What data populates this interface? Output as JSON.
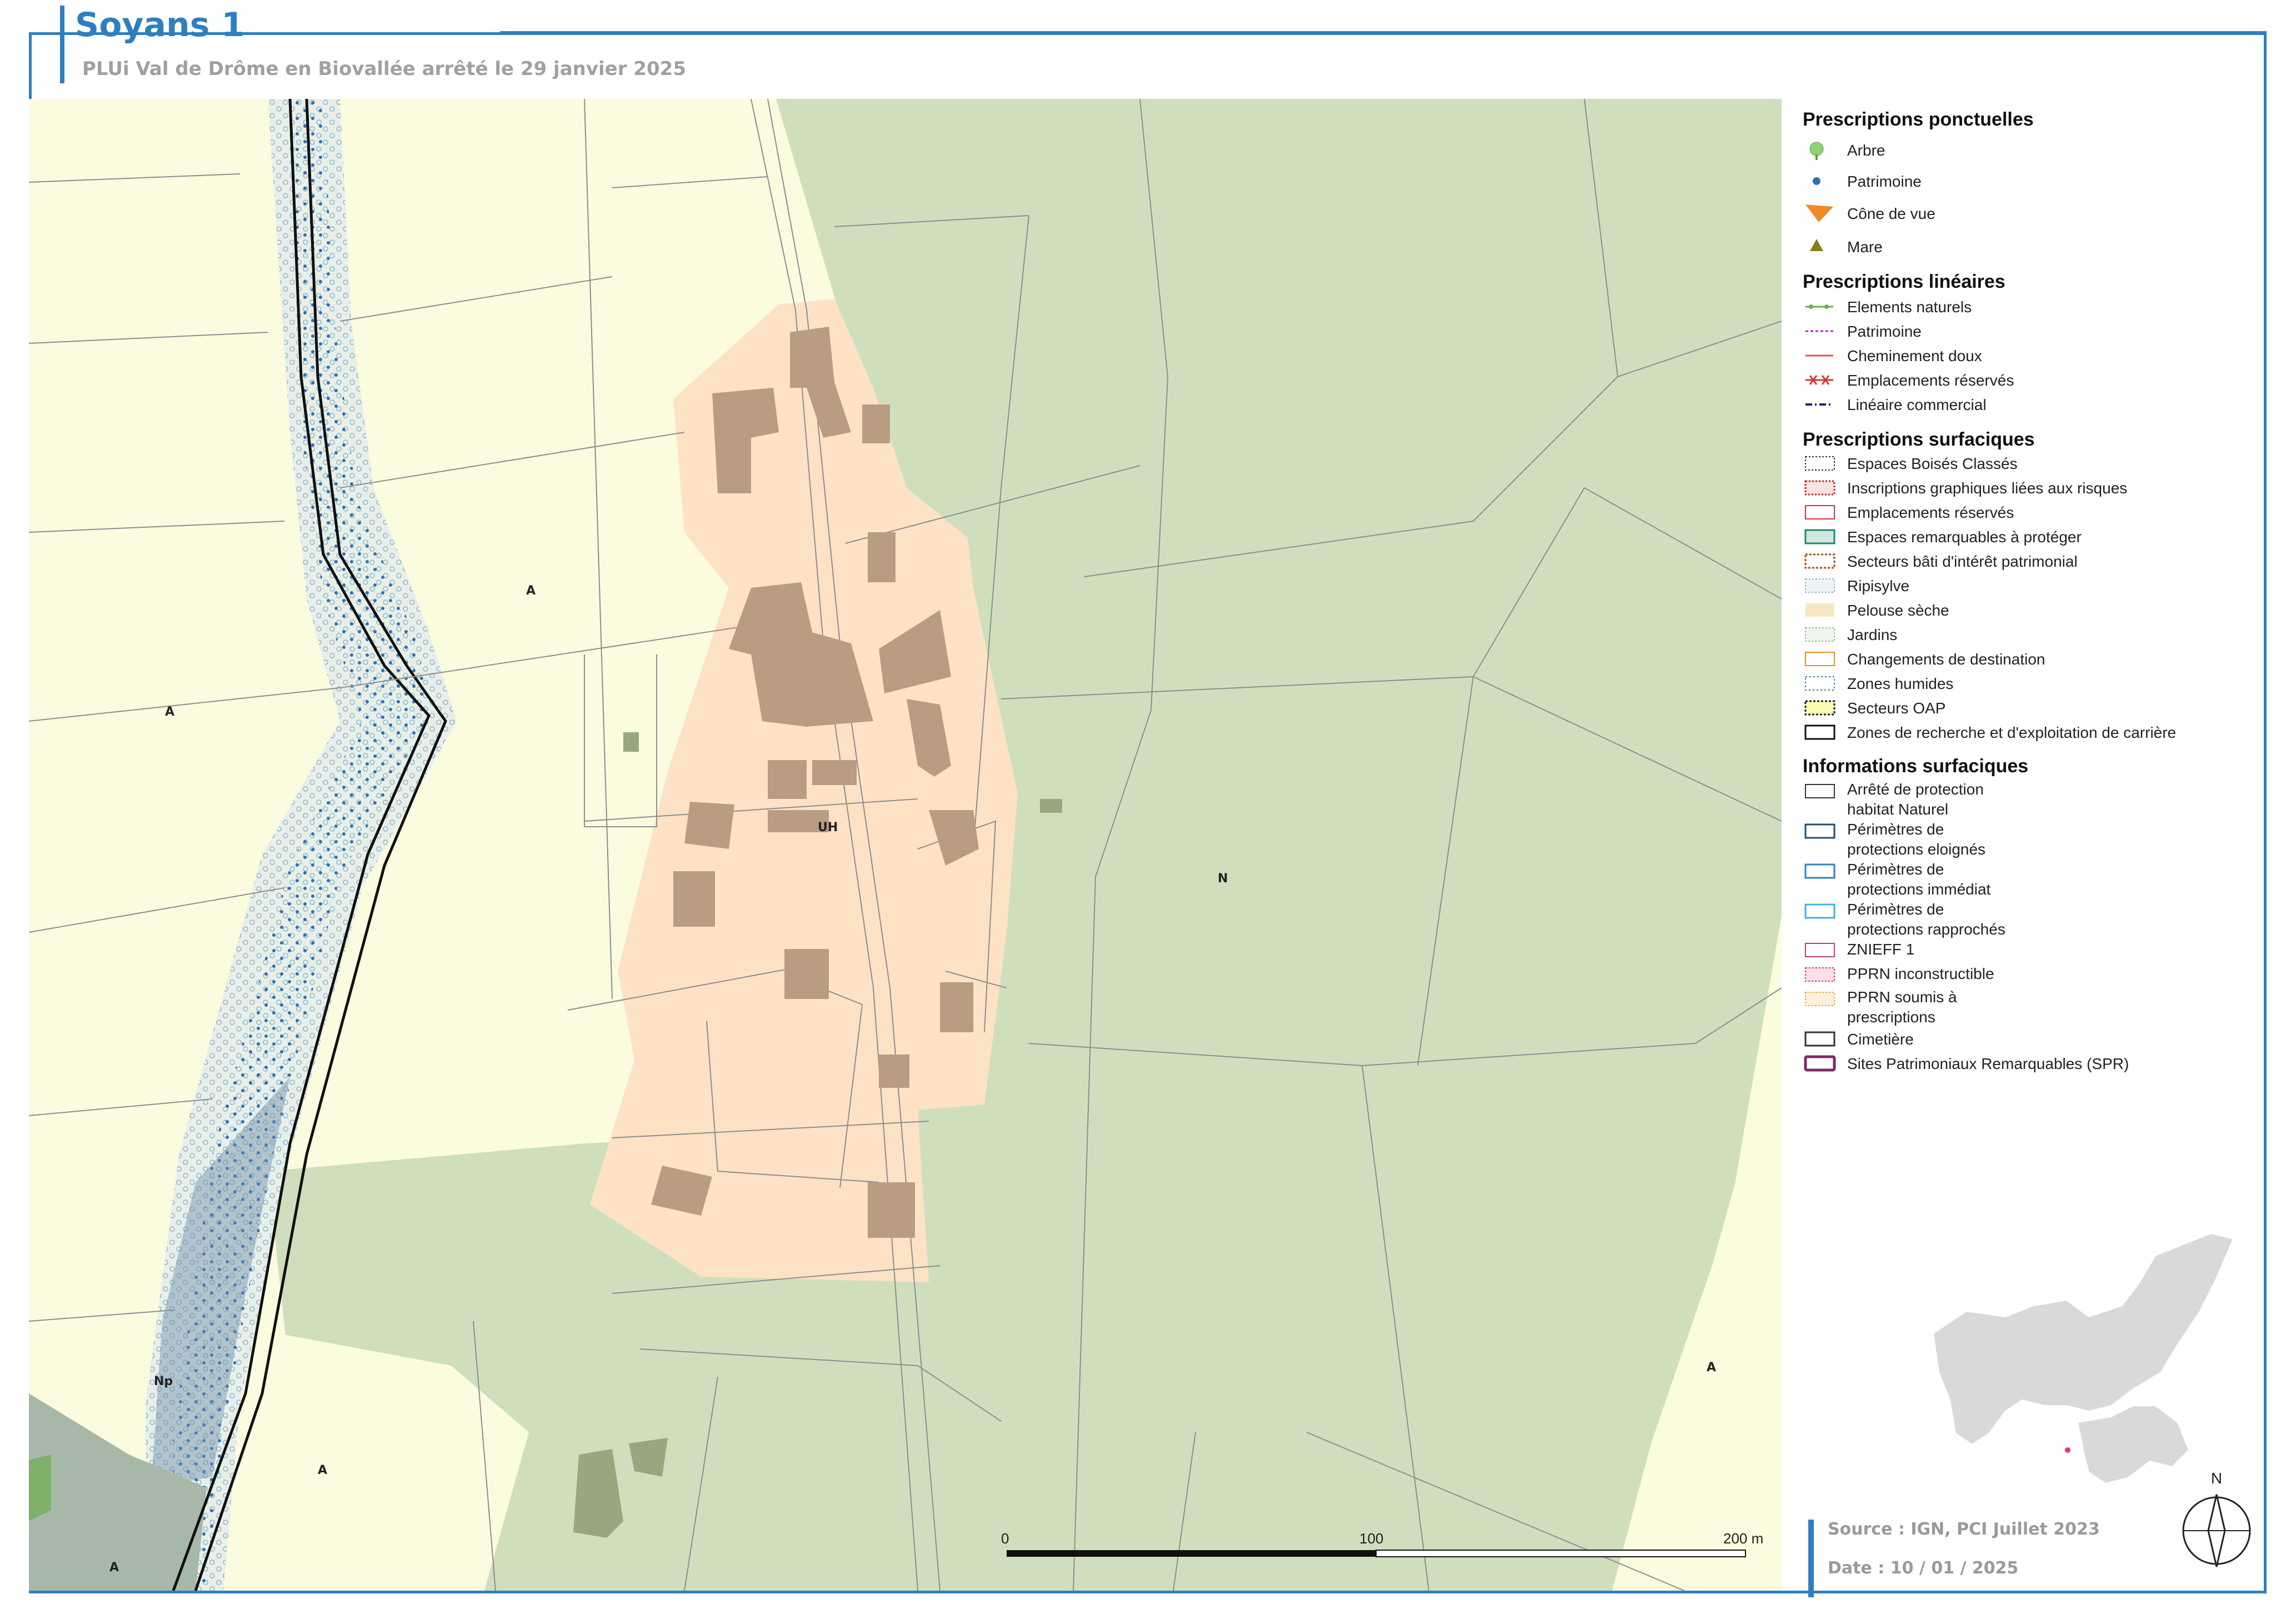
{
  "header": {
    "title": "Soyans 1",
    "subtitle": "PLUi Val de Drôme en Biovallée arrêté le 29 janvier 2025"
  },
  "map": {
    "zones": [
      {
        "label": "A",
        "type": "agricole"
      },
      {
        "label": "A",
        "type": "agricole"
      },
      {
        "label": "A",
        "type": "agricole"
      },
      {
        "label": "A",
        "type": "agricole"
      },
      {
        "label": "A",
        "type": "agricole"
      },
      {
        "label": "UH",
        "type": "urbaine"
      },
      {
        "label": "N",
        "type": "naturelle"
      },
      {
        "label": "Np",
        "type": "naturelle"
      }
    ],
    "colors": {
      "agricole": "#fafbdf",
      "naturelle": "#cfdfbe",
      "urbaine": "#fde2c6",
      "bati": "#b8a086",
      "bati_n": "#98a77f",
      "ripisylve": "#dde7e4"
    },
    "scale_labels": [
      "0",
      "100",
      "200 m"
    ]
  },
  "legend": {
    "ponctuelles": {
      "title": "Prescriptions ponctuelles",
      "items": [
        {
          "label": "Arbre",
          "icon": "tree-icon"
        },
        {
          "label": "Patrimoine",
          "icon": "dot-icon"
        },
        {
          "label": "Cône de vue",
          "icon": "view-cone-icon"
        },
        {
          "label": "Mare",
          "icon": "triangle-icon"
        }
      ]
    },
    "lineaires": {
      "title": "Prescriptions linéaires",
      "items": [
        {
          "label": "Elements naturels"
        },
        {
          "label": "Patrimoine"
        },
        {
          "label": "Cheminement doux"
        },
        {
          "label": "Emplacements réservés"
        },
        {
          "label": "Linéaire commercial"
        }
      ]
    },
    "surfaciques": {
      "title": "Prescriptions surfaciques",
      "items": [
        {
          "label": "Espaces Boisés Classés"
        },
        {
          "label": "Inscriptions graphiques liées aux risques"
        },
        {
          "label": "Emplacements réservés"
        },
        {
          "label": "Espaces remarquables à protéger"
        },
        {
          "label": "Secteurs bâti d'intérêt patrimonial"
        },
        {
          "label": "Ripisylve"
        },
        {
          "label": "Pelouse sèche"
        },
        {
          "label": "Jardins"
        },
        {
          "label": "Changements de destination"
        },
        {
          "label": "Zones humides"
        },
        {
          "label": "Secteurs OAP"
        },
        {
          "label": "Zones de recherche et d'exploitation de carrière"
        }
      ]
    },
    "informations": {
      "title": "Informations surfaciques",
      "items": [
        {
          "line1": "Arrêté de protection",
          "line2": "habitat Naturel"
        },
        {
          "line1": "Périmètres de",
          "line2": "protections eloignés"
        },
        {
          "line1": "Périmètres de",
          "line2": "protections immédiat"
        },
        {
          "line1": "Périmètres de",
          "line2": "protections rapprochés"
        },
        {
          "line1": "ZNIEFF 1",
          "line2": ""
        },
        {
          "line1": "PPRN inconstructible",
          "line2": ""
        },
        {
          "line1": "PPRN soumis à",
          "line2": "prescriptions"
        },
        {
          "line1": "Cimetière",
          "line2": ""
        },
        {
          "line1": "Sites Patrimoniaux Remarquables (SPR)",
          "line2": ""
        }
      ]
    }
  },
  "footer": {
    "source": "Source : IGN, PCI Juillet 2023",
    "date": "Date : 10 / 01 / 2025",
    "north_label": "N"
  }
}
